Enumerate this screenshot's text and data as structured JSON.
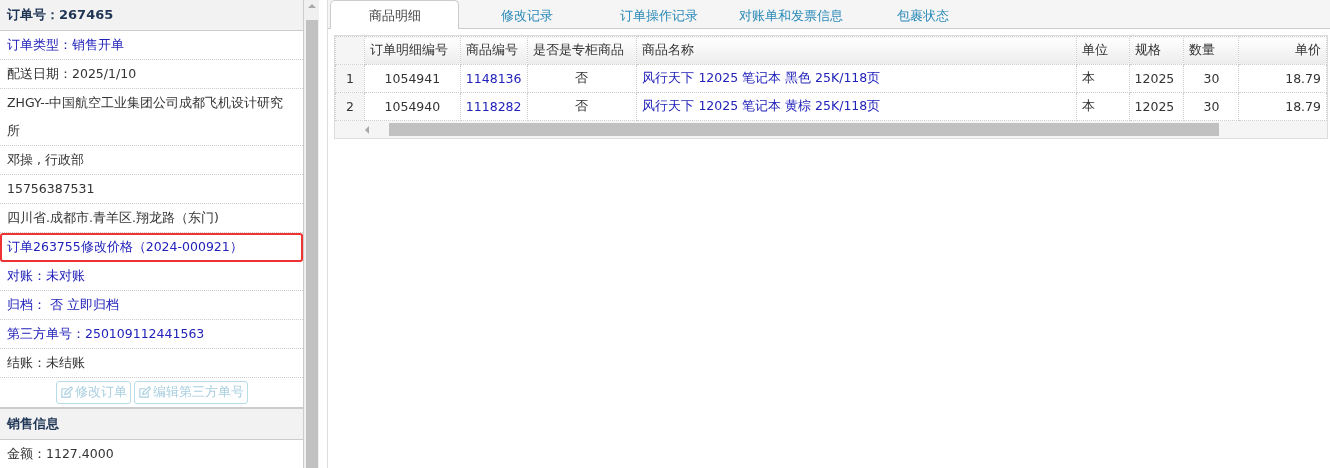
{
  "order_panel": {
    "title": "订单号：267465",
    "rows": [
      {
        "text": "订单类型：销售开单",
        "kind": "link",
        "highlighted": false
      },
      {
        "text": "配送日期：2025/1/10",
        "kind": "plain",
        "highlighted": false
      },
      {
        "text": "ZHGY--中国航空工业集团公司成都飞机设计研究所",
        "kind": "plain",
        "highlighted": false
      },
      {
        "text": "邓操 , 行政部",
        "kind": "plain",
        "highlighted": false
      },
      {
        "text": "15756387531",
        "kind": "plain",
        "highlighted": false
      },
      {
        "text": "四川省.成都市.青羊区.翔龙路（东门)",
        "kind": "plain",
        "highlighted": false
      },
      {
        "text": "订单263755修改价格（2024-000921）",
        "kind": "link",
        "highlighted": true
      },
      {
        "text": "对账：未对账",
        "kind": "link",
        "highlighted": false
      },
      {
        "text": "归档： 否 立即归档",
        "kind": "link",
        "highlighted": false
      },
      {
        "text": "第三方单号：250109112441563",
        "kind": "link",
        "highlighted": false
      },
      {
        "text": "结账：未结账",
        "kind": "plain",
        "highlighted": false
      }
    ],
    "buttons": [
      {
        "label": "修改订单",
        "disabled": true
      },
      {
        "label": "编辑第三方单号",
        "disabled": true
      }
    ]
  },
  "sales_panel": {
    "title": "销售信息",
    "rows": [
      {
        "text": "金额：1127.4000"
      }
    ]
  },
  "tabs": [
    {
      "label": "商品明细",
      "selected": true
    },
    {
      "label": "修改记录",
      "selected": false
    },
    {
      "label": "订单操作记录",
      "selected": false
    },
    {
      "label": "对账单和发票信息",
      "selected": false
    },
    {
      "label": "包裹状态",
      "selected": false
    }
  ],
  "table": {
    "columns": [
      {
        "label": "订单明细编号",
        "kind": "text"
      },
      {
        "label": "商品编号",
        "kind": "link"
      },
      {
        "label": "是否是专柜商品",
        "kind": "text"
      },
      {
        "label": "商品名称",
        "kind": "link"
      },
      {
        "label": "单位",
        "kind": "text"
      },
      {
        "label": "规格",
        "kind": "text"
      },
      {
        "label": "数量",
        "kind": "text"
      },
      {
        "label": "单价",
        "kind": "text"
      }
    ],
    "rows": [
      {
        "number": "1",
        "cells": [
          "1054941",
          "1148136",
          "否",
          "风行天下 12025 笔记本 黑色 25K/118页",
          "本",
          "12025",
          "30",
          "18.79"
        ]
      },
      {
        "number": "2",
        "cells": [
          "1054940",
          "1118282",
          "否",
          "风行天下 12025 笔记本 黄棕 25K/118页",
          "本",
          "12025",
          "30",
          "18.79"
        ]
      }
    ]
  }
}
